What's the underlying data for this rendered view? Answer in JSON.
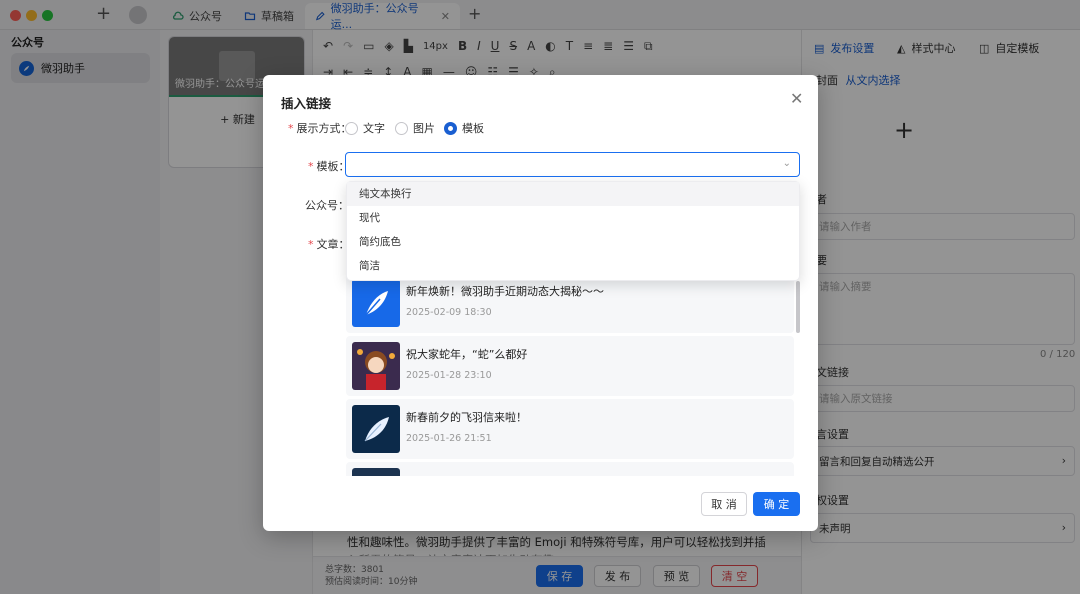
{
  "titlebar": {
    "tabs": [
      {
        "label": "公众号",
        "icon": "cloud-icon"
      },
      {
        "label": "草稿箱",
        "icon": "folder-icon"
      },
      {
        "label": "微羽助手：公众号运...",
        "icon": "edit-icon",
        "active": true
      }
    ]
  },
  "sidebar": {
    "heading": "公众号",
    "items": [
      {
        "label": "微羽助手",
        "icon": "feather-logo-icon"
      }
    ]
  },
  "article_col": {
    "card_title": "微羽助手：公众号运",
    "new_label": "+ 新建"
  },
  "editor": {
    "font_size": "14px",
    "body_line1": "性和趣味性。微羽助手提供了丰富的 Emoji 和特殊符号库，用户可以轻松找到并插",
    "body_line2": "入所需的符号，让文章表达更加生动有趣。",
    "stats_words": "总字数：3801",
    "stats_time": "预估阅读时间：10分钟",
    "buttons": {
      "save": "保 存",
      "publish": "发 布",
      "preview": "预 览",
      "clear": "清 空"
    }
  },
  "right_panel": {
    "tabs": [
      {
        "label": "发布设置",
        "icon": "settings-doc-icon",
        "active": true
      },
      {
        "label": "样式中心",
        "icon": "paint-icon"
      },
      {
        "label": "自定模板",
        "icon": "template-icon"
      }
    ],
    "cover_label": "封面",
    "cover_link": "从文内选择",
    "add_symbol": "+",
    "author_label": "者",
    "author_placeholder": "请输入作者",
    "summary_label": "要",
    "summary_placeholder": "请输入摘要",
    "summary_count": "0 / 120",
    "source_label": "文链接",
    "source_placeholder": "请输入原文链接",
    "comment_label": "言设置",
    "comment_value": "留言和回复自动精选公开",
    "copyright_label": "权设置",
    "copyright_value": "未声明"
  },
  "modal": {
    "title": "插入链接",
    "display_label": "展示方式：",
    "radios": [
      "文字",
      "图片",
      "模板"
    ],
    "selected_radio": "模板",
    "template_label": "模板：",
    "account_label": "公众号：",
    "article_label": "文章：",
    "dropdown_options": [
      "纯文本换行",
      "现代",
      "简约底色",
      "简洁"
    ],
    "articles": [
      {
        "title": "新年焕新！微羽助手近期动态大揭秘～～",
        "date": "2025-02-09 18:30"
      },
      {
        "title": "祝大家蛇年，“蛇”么都好",
        "date": "2025-01-28 23:10"
      },
      {
        "title": "新春前夕的飞羽信来啦！",
        "date": "2025-01-26 21:51"
      }
    ],
    "cancel": "取 消",
    "confirm": "确 定"
  },
  "colors": {
    "accent": "#1a6ff0",
    "danger": "#e5484d"
  }
}
